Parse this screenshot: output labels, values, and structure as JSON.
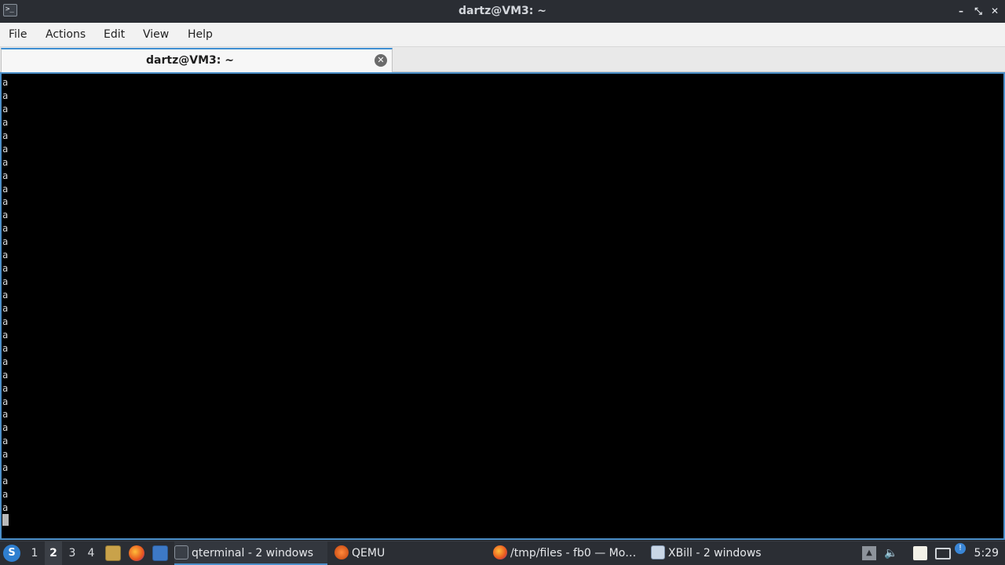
{
  "window": {
    "title": "dartz@VM3: ~",
    "icon": "terminal-icon",
    "minimize_glyph": "–",
    "maximize_glyph": "⤡",
    "close_glyph": "✕"
  },
  "menubar": {
    "items": [
      "File",
      "Actions",
      "Edit",
      "View",
      "Help"
    ]
  },
  "tabs": [
    {
      "label": "dartz@VM3: ~",
      "close_glyph": "✕"
    }
  ],
  "terminal": {
    "lines": [
      "a",
      "a",
      "a",
      "a",
      "a",
      "a",
      "a",
      "a",
      "a",
      "a",
      "a",
      "a",
      "a",
      "a",
      "a",
      "a",
      "a",
      "a",
      "a",
      "a",
      "a",
      "a",
      "a",
      "a",
      "a",
      "a",
      "a",
      "a",
      "a",
      "a",
      "a",
      "a",
      "a"
    ]
  },
  "taskbar": {
    "start_icon": "start-menu-icon",
    "workspaces": [
      "1",
      "2",
      "3",
      "4"
    ],
    "active_workspace": "2",
    "quick_launch": [
      "file-manager-icon",
      "firefox-icon",
      "desktop-icon"
    ],
    "tasks": [
      {
        "label": "qterminal - 2 windows",
        "icon": "terminal-icon",
        "active": true
      },
      {
        "label": "QEMU",
        "icon": "qemu-icon",
        "active": false
      },
      {
        "label": "/tmp/files - fb0 — Mo…",
        "icon": "firefox-icon",
        "active": false
      },
      {
        "label": "XBill - 2 windows",
        "icon": "window-icon",
        "active": false
      }
    ],
    "tray": [
      "upload-icon",
      "volume-icon",
      "clipboard-icon",
      "network-icon",
      "notification-icon"
    ],
    "clock": "5:29"
  },
  "colors": {
    "accent": "#4b8fc9",
    "terminal_bg": "#000000",
    "terminal_fg": "#d9d9d9",
    "taskbar_bg": "#2b2e34"
  }
}
